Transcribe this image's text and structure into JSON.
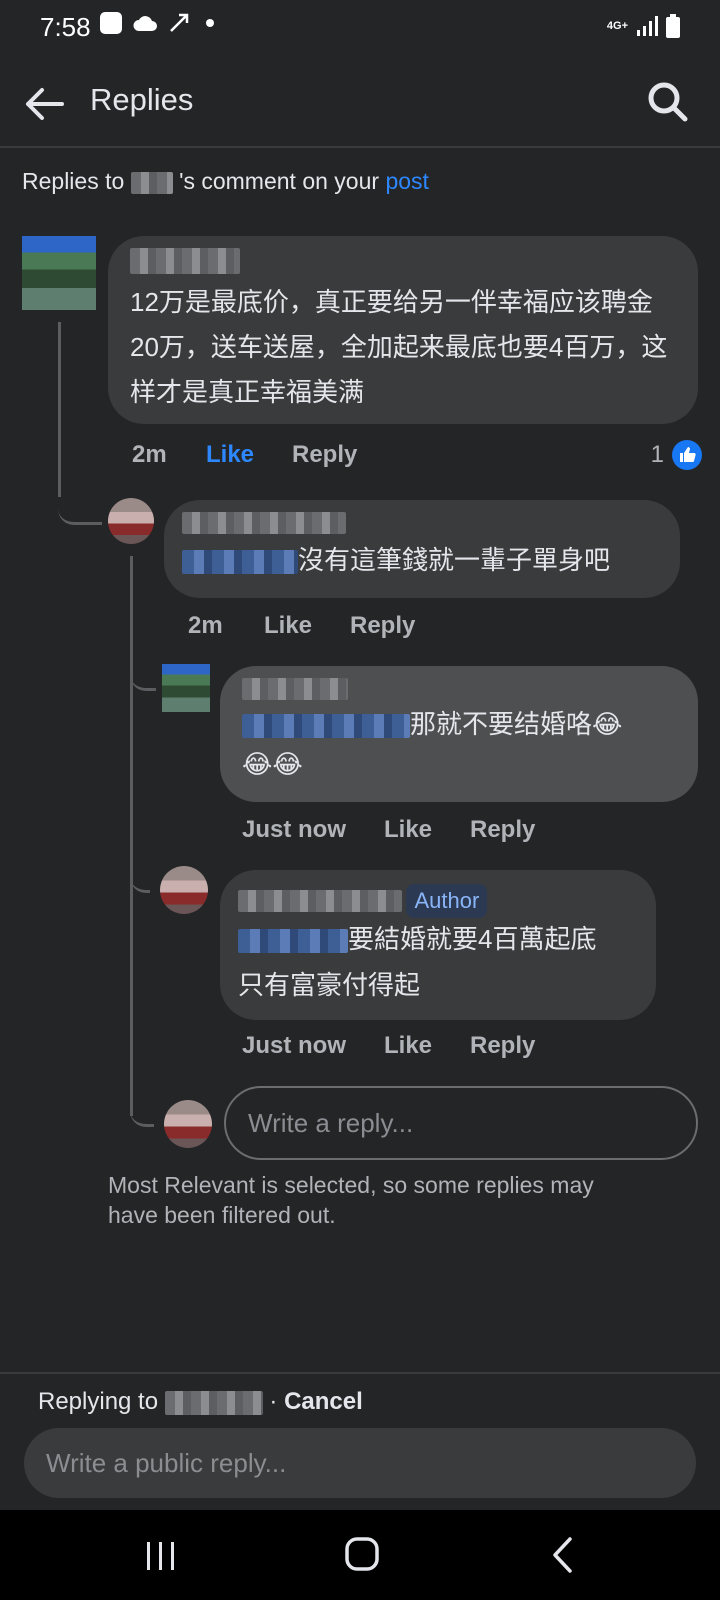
{
  "status_bar": {
    "time": "7:58",
    "network": "4G+"
  },
  "header": {
    "title": "Replies"
  },
  "subheader": {
    "prefix": "Replies to",
    "middle": "'s comment on your",
    "link": "post"
  },
  "comments": [
    {
      "text": "12万是最底价，真正要给另一伴幸福应该聘金20万，送车送屋，全加起来最底也要4百万，这样才是真正幸福美满",
      "time": "2m",
      "like": "Like",
      "reply": "Reply",
      "reactions": "1"
    },
    {
      "text": "沒有這筆錢就一輩子單身吧",
      "time": "2m",
      "like": "Like",
      "reply": "Reply"
    },
    {
      "text": "那就不要结婚咯😂",
      "text2": "😂😂",
      "time": "Just now",
      "like": "Like",
      "reply": "Reply"
    },
    {
      "badge": "Author",
      "text": "要結婚就要4百萬起底",
      "text2": "只有富豪付得起",
      "time": "Just now",
      "like": "Like",
      "reply": "Reply"
    }
  ],
  "thread_reply": {
    "placeholder": "Write a reply..."
  },
  "filter_note": "Most Relevant is selected, so some replies may have been filtered out.",
  "footer": {
    "replying_to": "Replying to",
    "separator": "·",
    "cancel": "Cancel",
    "placeholder": "Write a public reply..."
  }
}
